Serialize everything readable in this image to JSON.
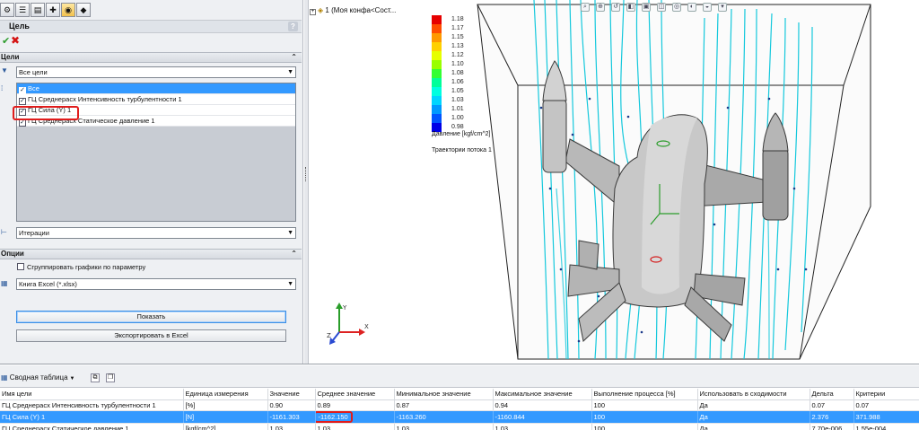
{
  "toolbar_icons": [
    "flow-sim-icon",
    "property-icon",
    "config-icon",
    "target-icon",
    "display-icon",
    "appearance-icon"
  ],
  "panel": {
    "title": "Цель",
    "help": "?",
    "ok_icon": "check-icon",
    "cancel_icon": "close-icon"
  },
  "goals_section": {
    "header": "Цели",
    "filter": "Все цели",
    "items": [
      {
        "label": "Все",
        "checked": true,
        "selected": true
      },
      {
        "label": "ГЦ Среднерасх Интенсивность турбулентности 1",
        "checked": true,
        "selected": false
      },
      {
        "label": "ГЦ Сила (Y) 1",
        "checked": true,
        "selected": false,
        "highlighted": true
      },
      {
        "label": "ГЦ Среднерасх Статическое давление 1",
        "checked": true,
        "selected": false
      }
    ],
    "x_axis": "Итерации"
  },
  "options_section": {
    "header": "Опции",
    "group_checkbox": "Сгруппировать графики по параметру",
    "group_checked": false,
    "format": "Книга Excel (*.xlsx)"
  },
  "buttons": {
    "show": "Показать",
    "export": "Экспортировать в Excel"
  },
  "viewport": {
    "tree_item": "1  (Моя конфа<Сост...",
    "legend": {
      "labels": [
        "1.18",
        "1.17",
        "1.15",
        "1.13",
        "1.12",
        "1.10",
        "1.08",
        "1.06",
        "1.05",
        "1.03",
        "1.01",
        "1.00",
        "0.98"
      ],
      "colors": [
        "#e60000",
        "#ff4d00",
        "#ff9900",
        "#ffd000",
        "#e6ff00",
        "#99ff00",
        "#33ff33",
        "#00ff99",
        "#00ffe0",
        "#00d5ff",
        "#0099ff",
        "#0055ff",
        "#0000e6"
      ],
      "caption": "Давление [kgf/cm^2]"
    },
    "flow_caption": "Траектории потока 1",
    "triad": {
      "y": "Y",
      "x": "X",
      "z": "Z"
    },
    "view_toolbar_icons": [
      "zoom-icon",
      "zoom-area-icon",
      "prev-view-icon",
      "section-icon",
      "view-orient-icon",
      "display-style-icon",
      "hide-show-icon",
      "edit-appearance-icon",
      "scene-icon",
      "view-settings-icon"
    ]
  },
  "summary": {
    "title": "Сводная таблица",
    "toolbar_icons": [
      "copy-icon",
      "paste-icon"
    ],
    "columns": [
      "Имя цели",
      "Единица измерения",
      "Значение",
      "Среднее значение",
      "Минимальное значение",
      "Максимальное значение",
      "Выполнение процесса [%]",
      "Использовать в сходимости",
      "Дельта",
      "Критерии"
    ],
    "rows": [
      [
        "ГЦ Среднерасх Интенсивность турбулентности 1",
        "[%]",
        "0.90",
        "0.89",
        "0.87",
        "0.94",
        "100",
        "Да",
        "0.07",
        "0.07"
      ],
      [
        "ГЦ Сила (Y) 1",
        "[N]",
        "-1161.303",
        "-1162.150",
        "-1163.260",
        "-1160.844",
        "100",
        "Да",
        "2.376",
        "371.988"
      ],
      [
        "ГЦ Среднерасх Статическое давление 1",
        "[kgf/cm^2]",
        "1.03",
        "1.03",
        "1.03",
        "1.03",
        "100",
        "Да",
        "7.70e-006",
        "1.55e-004"
      ]
    ],
    "selected_row": 1
  }
}
